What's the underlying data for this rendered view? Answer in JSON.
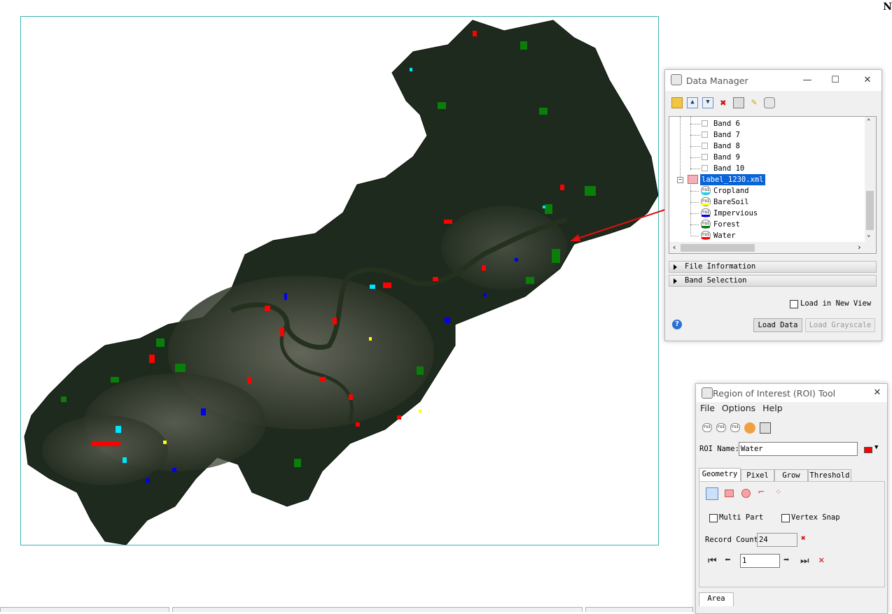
{
  "corner_text": "N",
  "data_manager": {
    "title": "Data Manager",
    "toolbar_icons": [
      "open-file-icon",
      "expand-up-icon",
      "expand-down-icon",
      "remove-icon",
      "close-all-icon",
      "pin-icon",
      "export-icon"
    ],
    "bands": [
      "Band 6",
      "Band 7",
      "Band 8",
      "Band 9",
      "Band 10"
    ],
    "roi_file": "label_1230.xml",
    "rois": [
      {
        "name": "Cropland",
        "color": "#00e5ff"
      },
      {
        "name": "BareSoil",
        "color": "#ffff00"
      },
      {
        "name": "Impervious",
        "color": "#0000ff"
      },
      {
        "name": "Forest",
        "color": "#008000"
      },
      {
        "name": "Water",
        "color": "#ff0000"
      }
    ],
    "sections": [
      "File Information",
      "Band Selection"
    ],
    "load_new_view_label": "Load in New View",
    "load_data_label": "Load Data",
    "load_grayscale_label": "Load Grayscale"
  },
  "roi_tool": {
    "title": "Region of Interest (ROI) Tool",
    "menu": [
      "File",
      "Options",
      "Help"
    ],
    "roi_name_label": "ROI Name:",
    "roi_name_value": "Water",
    "roi_color": "#ff0000",
    "tabs": [
      "Geometry",
      "Pixel",
      "Grow",
      "Threshold"
    ],
    "multi_part_label": "Multi Part",
    "vertex_snap_label": "Vertex Snap",
    "record_count_label": "Record Count",
    "record_count_value": "24",
    "record_index_value": "1",
    "bottom_tab": "Area"
  }
}
